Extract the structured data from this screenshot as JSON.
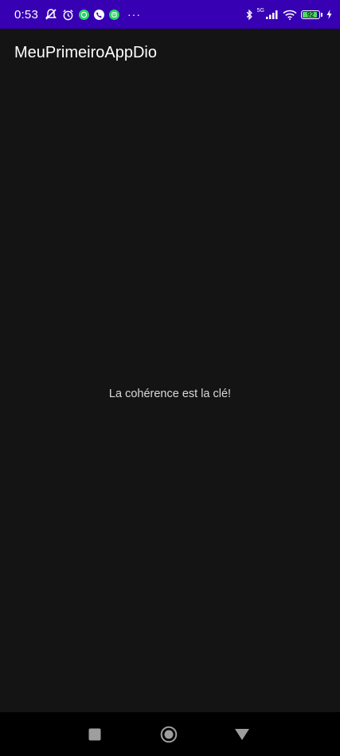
{
  "status_bar": {
    "time": "0:53",
    "network_label": "5G",
    "battery_level": "92",
    "battery_fraction": 0.92,
    "more_indicator": "···",
    "icons": [
      "mute-icon",
      "alarm-icon",
      "whatsapp-icon",
      "phone-call-icon",
      "whatsapp-icon",
      "bluetooth-icon",
      "signal-icon",
      "wifi-icon",
      "battery-icon",
      "charging-icon"
    ],
    "background_color": "#3700b3"
  },
  "app_bar": {
    "title": "MeuPrimeiroAppDio"
  },
  "content": {
    "message": "La cohérence est la clé!"
  },
  "nav_bar": {
    "buttons": [
      "recents-icon",
      "home-icon",
      "back-icon"
    ]
  }
}
